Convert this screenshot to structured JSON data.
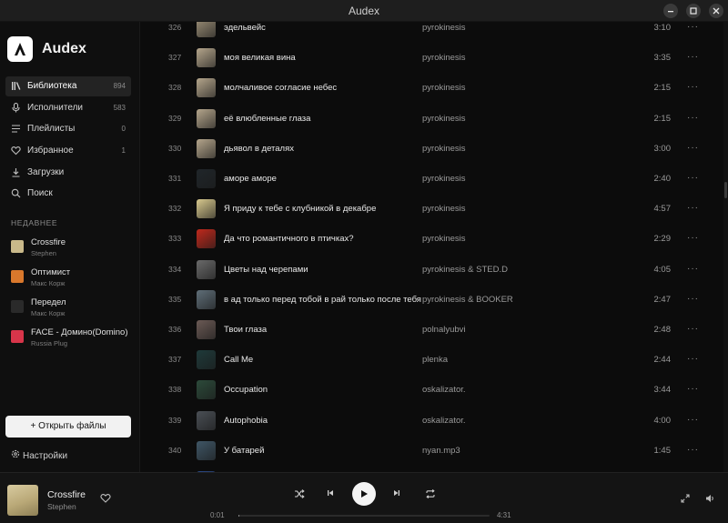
{
  "window": {
    "title": "Audex"
  },
  "app": {
    "name": "Audex"
  },
  "sidebar": {
    "nav": [
      {
        "label": "Библиотека",
        "count": "894",
        "icon": "library-icon",
        "active": true
      },
      {
        "label": "Исполнители",
        "count": "583",
        "icon": "microphone-icon",
        "active": false
      },
      {
        "label": "Плейлисты",
        "count": "0",
        "icon": "playlist-icon",
        "active": false
      },
      {
        "label": "Избранное",
        "count": "1",
        "icon": "heart-icon",
        "active": false
      },
      {
        "label": "Загрузки",
        "count": "",
        "icon": "download-icon",
        "active": false
      },
      {
        "label": "Поиск",
        "count": "",
        "icon": "search-icon",
        "active": false
      }
    ],
    "recent_label": "НЕДАВНЕЕ",
    "recent": [
      {
        "title": "Crossfire",
        "artist": "Stephen",
        "color": "#c9b98a"
      },
      {
        "title": "Оптимист",
        "artist": "Макс Корж",
        "color": "#d9782c"
      },
      {
        "title": "Передел",
        "artist": "Макс Корж",
        "color": "#2a2a2a"
      },
      {
        "title": "FACE - Домино(Domino)",
        "artist": "Russia Plug",
        "color": "#d8354a"
      }
    ],
    "open_files_label": "Открыть файлы",
    "settings_label": "Настройки"
  },
  "tracks": [
    {
      "num": "326",
      "title": "эдельвейс",
      "artist": "pyrokinesis",
      "duration": "3:10",
      "art": "#9c8f77"
    },
    {
      "num": "327",
      "title": "моя великая вина",
      "artist": "pyrokinesis",
      "duration": "3:35",
      "art": "#b5a68c"
    },
    {
      "num": "328",
      "title": "молчаливое согласие небес",
      "artist": "pyrokinesis",
      "duration": "2:15",
      "art": "#b5a68c"
    },
    {
      "num": "329",
      "title": "её влюбленные глаза",
      "artist": "pyrokinesis",
      "duration": "2:15",
      "art": "#b5a68c"
    },
    {
      "num": "330",
      "title": "дьявол в деталях",
      "artist": "pyrokinesis",
      "duration": "3:00",
      "art": "#b5a68c"
    },
    {
      "num": "331",
      "title": "аморе аморе",
      "artist": "pyrokinesis",
      "duration": "2:40",
      "art": "#20262a"
    },
    {
      "num": "332",
      "title": "Я приду к тебе с клубникой в декабре",
      "artist": "pyrokinesis",
      "duration": "4:57",
      "art": "#d8c98e"
    },
    {
      "num": "333",
      "title": "Да что романтичного в птичках?",
      "artist": "pyrokinesis",
      "duration": "2:29",
      "art": "#c0291c"
    },
    {
      "num": "334",
      "title": "Цветы над черепами",
      "artist": "pyrokinesis & STED.D",
      "duration": "4:05",
      "art": "#6a6a6a"
    },
    {
      "num": "335",
      "title": "в ад только перед тобой в рай только после тебя",
      "artist": "pyrokinesis & BOOKER",
      "duration": "2:47",
      "art": "#5f6e78"
    },
    {
      "num": "336",
      "title": "Твои глаза",
      "artist": "polnalyubvi",
      "duration": "2:48",
      "art": "#6b5a55"
    },
    {
      "num": "337",
      "title": "Call Me",
      "artist": "plenka",
      "duration": "2:44",
      "art": "#1f3a3a"
    },
    {
      "num": "338",
      "title": "Occupation",
      "artist": "oskalizator.",
      "duration": "3:44",
      "art": "#2c4a3a"
    },
    {
      "num": "339",
      "title": "Autophobia",
      "artist": "oskalizator.",
      "duration": "4:00",
      "art": "#4a4f55"
    },
    {
      "num": "340",
      "title": "У батарей",
      "artist": "nyan.mp3",
      "duration": "1:45",
      "art": "#3f5666"
    },
    {
      "num": "",
      "title": "",
      "artist": "",
      "duration": "",
      "art": "#2b4a8a"
    }
  ],
  "player": {
    "title": "Crossfire",
    "artist": "Stephen",
    "current_time": "0:01",
    "total_time": "4:31",
    "progress": 0.004
  }
}
